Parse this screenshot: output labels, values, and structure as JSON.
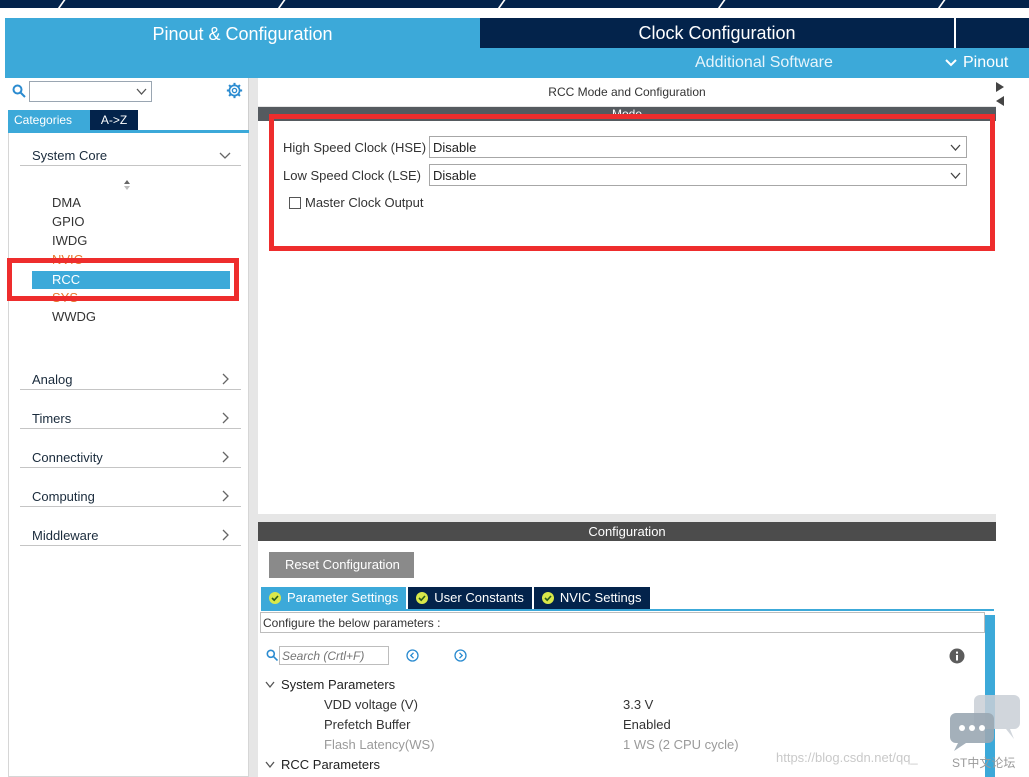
{
  "header": {
    "tab_pinout": "Pinout & Configuration",
    "tab_clock": "Clock Configuration",
    "additional_software": "Additional Software",
    "pinout_menu": "Pinout"
  },
  "sidebar": {
    "search_value": "",
    "tabs": [
      "Categories",
      "A->Z"
    ],
    "system_core": {
      "label": "System Core",
      "items": [
        "DMA",
        "GPIO",
        "IWDG",
        "NVIC",
        "RCC",
        "SYS",
        "WWDG"
      ]
    },
    "groups": [
      "Analog",
      "Timers",
      "Connectivity",
      "Computing",
      "Middleware"
    ]
  },
  "main": {
    "title": "RCC Mode and Configuration",
    "mode": {
      "bar_label": "Mode",
      "hse_label": "High Speed Clock (HSE)",
      "hse_value": "Disable",
      "lse_label": "Low Speed Clock (LSE)",
      "lse_value": "Disable",
      "mco_label": "Master Clock Output",
      "mco_checked": false
    },
    "configuration": {
      "bar_label": "Configuration",
      "reset_label": "Reset Configuration",
      "tabs": [
        "Parameter Settings",
        "User Constants",
        "NVIC Settings"
      ],
      "hint": "Configure the below parameters :",
      "search_placeholder": "Search (Crtl+F)",
      "system_params": {
        "label": "System Parameters",
        "rows": [
          {
            "name": "VDD voltage (V)",
            "value": "3.3 V"
          },
          {
            "name": "Prefetch Buffer",
            "value": "Enabled"
          },
          {
            "name": "Flash Latency(WS)",
            "value": "1 WS (2 CPU cycle)"
          }
        ]
      },
      "rcc_params": {
        "label": "RCC Parameters"
      }
    }
  },
  "colors": {
    "accent": "#3ca9d9",
    "navy": "#03234b",
    "highlight_red": "#ee2d2d",
    "warning_orange": "#e8772e"
  },
  "watermark": {
    "url": "https://blog.csdn.net/qq_",
    "caption": "ST中文论坛"
  }
}
